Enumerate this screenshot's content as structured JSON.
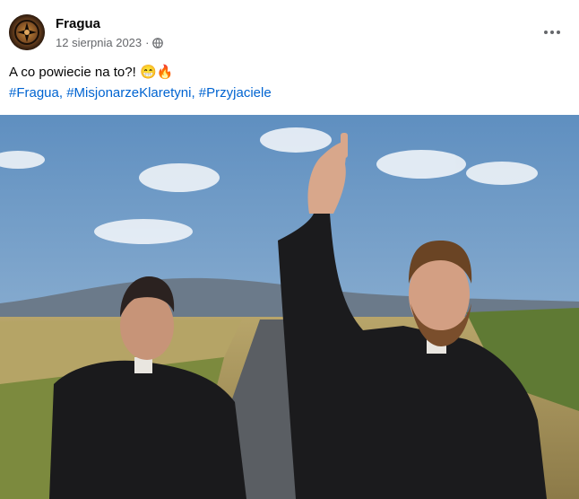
{
  "post": {
    "author": "Fragua",
    "date": "12 sierpnia 2023",
    "separator": "·",
    "text": "A co powiecie na to?!",
    "emoji": "😁🔥",
    "hashtags": [
      "#Fragua",
      "#MisjonarzeKlaretyni",
      "#Przyjaciele"
    ],
    "hashtag_separator": ", "
  },
  "icons": {
    "audience": "globe-icon",
    "more": "more-options-icon",
    "avatar": "page-logo"
  },
  "colors": {
    "author": "#050505",
    "meta": "#65676b",
    "link": "#0064d1",
    "sky": "#6d9cc8"
  }
}
